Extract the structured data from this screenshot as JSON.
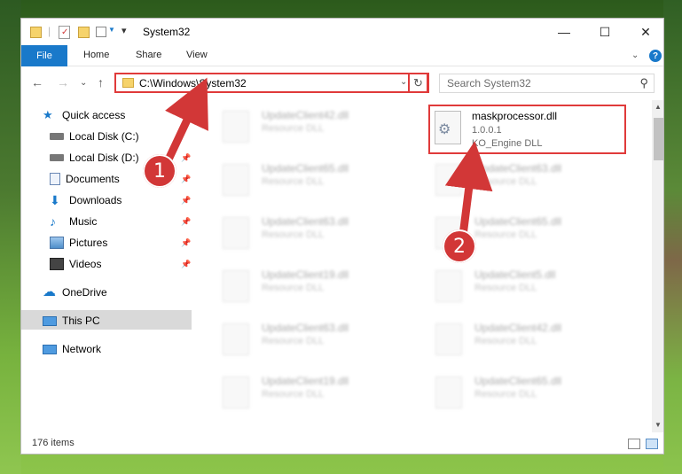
{
  "window": {
    "title": "System32",
    "controls": {
      "minimize": "—",
      "maximize": "☐",
      "close": "✕"
    }
  },
  "ribbon": {
    "file_tab": "File",
    "tabs": [
      "Home",
      "Share",
      "View"
    ],
    "help": "?"
  },
  "navigation": {
    "address_path": "C:\\Windows\\System32",
    "search_placeholder": "Search System32"
  },
  "sidebar": {
    "items": [
      {
        "label": "Quick access",
        "icon": "star-icon",
        "pinned": false
      },
      {
        "label": "Local Disk (C:)",
        "icon": "drive-icon",
        "pinned": false
      },
      {
        "label": "Local Disk (D:)",
        "icon": "drive-icon",
        "pinned": true
      },
      {
        "label": "Documents",
        "icon": "documents-icon",
        "pinned": true
      },
      {
        "label": "Downloads",
        "icon": "download-icon",
        "pinned": true
      },
      {
        "label": "Music",
        "icon": "music-icon",
        "pinned": true
      },
      {
        "label": "Pictures",
        "icon": "pictures-icon",
        "pinned": true
      },
      {
        "label": "Videos",
        "icon": "videos-icon",
        "pinned": true
      },
      {
        "label": "OneDrive",
        "icon": "cloud-icon",
        "pinned": false
      },
      {
        "label": "This PC",
        "icon": "computer-icon",
        "pinned": false,
        "selected": true
      },
      {
        "label": "Network",
        "icon": "network-icon",
        "pinned": false
      }
    ]
  },
  "files": {
    "featured": {
      "name": "maskprocessor.dll",
      "version": "1.0.0.1",
      "type": "KO_Engine DLL"
    },
    "left_column": [
      {
        "name": "UpdateClient42.dll",
        "type": "Resource DLL"
      },
      {
        "name": "UpdateClient65.dll",
        "type": "Resource DLL"
      },
      {
        "name": "UpdateClient63.dll",
        "type": "Resource DLL"
      },
      {
        "name": "UpdateClient19.dll",
        "type": "Resource DLL"
      },
      {
        "name": "UpdateClient63.dll",
        "type": "Resource DLL"
      },
      {
        "name": "UpdateClient19.dll",
        "type": "Resource DLL"
      }
    ],
    "right_column": [
      {
        "name": "UpdateClient63.dll",
        "type": "Resource DLL"
      },
      {
        "name": "UpdateClient65.dll",
        "type": "Resource DLL"
      },
      {
        "name": "UpdateClient5.dll",
        "type": "Resource DLL"
      },
      {
        "name": "UpdateClient42.dll",
        "type": "Resource DLL"
      },
      {
        "name": "UpdateClient65.dll",
        "type": "Resource DLL"
      }
    ]
  },
  "status": {
    "item_count": "176 items"
  },
  "annotations": {
    "step1": "1",
    "step2": "2",
    "accent": "#d23737"
  }
}
